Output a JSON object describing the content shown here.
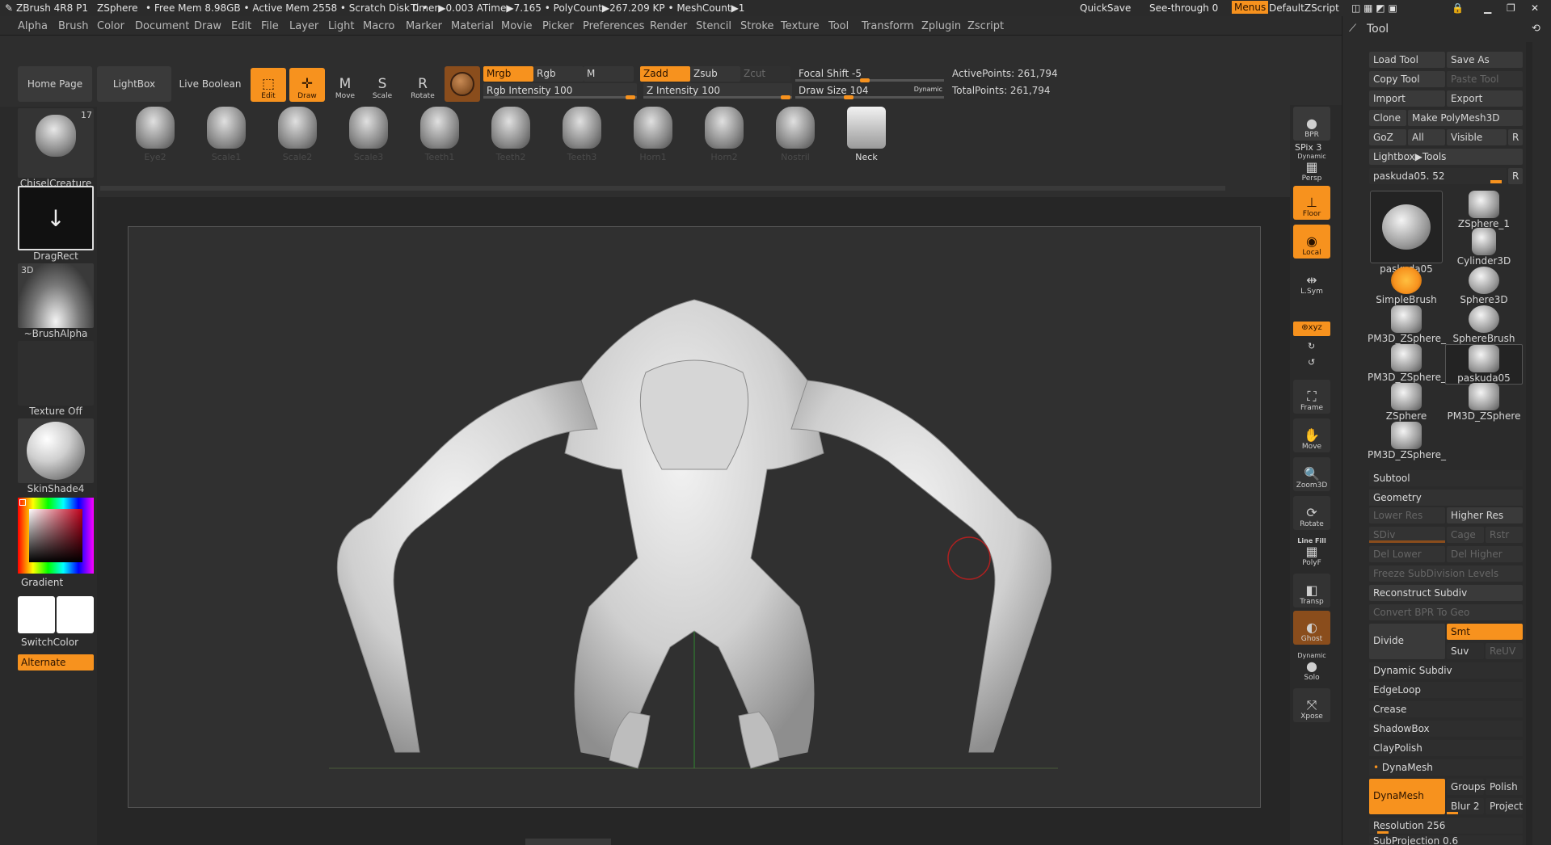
{
  "titlebar": {
    "app": "ZBrush 4R8 P1",
    "project": "ZSphere",
    "stats": "• Free Mem 8.98GB • Active Mem 2558 • Scratch Disk 0 •",
    "timer": "Timer▶0.003 ATime▶7.165 • PolyCount▶267.209 KP • MeshCount▶1",
    "quicksave": "QuickSave",
    "seethrough": "See-through  0",
    "menus": "Menus",
    "script": "DefaultZScript"
  },
  "menubar": [
    "Alpha",
    "Brush",
    "Color",
    "Document",
    "Draw",
    "Edit",
    "File",
    "Layer",
    "Light",
    "Macro",
    "Marker",
    "Material",
    "Movie",
    "Picker",
    "Preferences",
    "Render",
    "Stencil",
    "Stroke",
    "Texture",
    "Tool",
    "Transform",
    "Zplugin",
    "Zscript"
  ],
  "shelf": {
    "home": "Home Page",
    "lightbox": "LightBox",
    "liveboolean": "Live Boolean",
    "edit": "Edit",
    "draw": "Draw",
    "move": "Move",
    "scale": "Scale",
    "rotate": "Rotate",
    "mrgb": "Mrgb",
    "rgb": "Rgb",
    "m": "M",
    "zadd": "Zadd",
    "zsub": "Zsub",
    "zcut": "Zcut",
    "rgb_intensity": "Rgb Intensity 100",
    "z_intensity": "Z Intensity 100",
    "focal_shift": "Focal Shift -5",
    "draw_size": "Draw Size 104",
    "dynamic": "Dynamic",
    "active_points": "ActivePoints: 261,794",
    "total_points": "TotalPoints: 261,794"
  },
  "brushes": [
    "Eye2",
    "Scale1",
    "Scale2",
    "Scale3",
    "Teeth1",
    "Teeth2",
    "Teeth3",
    "Horn1",
    "Horn2",
    "Nostril",
    "Neck"
  ],
  "leftshelf": {
    "brush_count": "17",
    "brush": "ChiselCreature",
    "stroke": "DragRect",
    "alpha": "~BrushAlpha",
    "alpha_tag": "3D",
    "texture": "Texture Off",
    "material": "SkinShade4",
    "gradient": "Gradient",
    "switchcolor": "SwitchColor",
    "alternate": "Alternate"
  },
  "rightshelf": {
    "bpr": "BPR",
    "spix": "SPix 3",
    "dynamic": "Dynamic",
    "persp": "Persp",
    "floor": "Floor",
    "local": "Local",
    "lsym": "L.Sym",
    "xyz": "⊕xyz",
    "frame": "Frame",
    "move": "Move",
    "zoom": "Zoom3D",
    "rotate": "Rotate",
    "linefill": "Line Fill",
    "polyf": "PolyF",
    "transp": "Transp",
    "ghost": "Ghost",
    "dynamic2": "Dynamic",
    "solo": "Solo",
    "xpose": "Xpose"
  },
  "tool": {
    "title": "Tool",
    "load": "Load Tool",
    "saveas": "Save As",
    "copy": "Copy Tool",
    "paste": "Paste Tool",
    "import": "Import",
    "export": "Export",
    "clone": "Clone",
    "makepoly": "Make PolyMesh3D",
    "goz": "GoZ",
    "all": "All",
    "visible": "Visible",
    "r": "R",
    "lightbox_tools": "Lightbox▶Tools",
    "current": "paskuda05. 52",
    "r2": "R",
    "items": [
      "paskuda05",
      "ZSphere_1",
      "Cylinder3D",
      "SimpleBrush",
      "Sphere3D",
      "PM3D_ZSphere_",
      "SphereBrush",
      "PM3D_ZSphere_",
      "paskuda05",
      "ZSphere",
      "PM3D_ZSphere",
      "PM3D_ZSphere_"
    ],
    "subtool": "Subtool",
    "geometry": "Geometry",
    "lower_res": "Lower Res",
    "higher_res": "Higher Res",
    "sdiv": "SDiv",
    "cage": "Cage",
    "rstr": "Rstr",
    "del_lower": "Del Lower",
    "del_higher": "Del Higher",
    "freeze": "Freeze SubDivision Levels",
    "reconstruct": "Reconstruct Subdiv",
    "convert": "Convert BPR To Geo",
    "divide": "Divide",
    "smt": "Smt",
    "suv": "Suv",
    "reuv": "ReUV",
    "dyn_subdiv": "Dynamic Subdiv",
    "edgeloop": "EdgeLoop",
    "crease": "Crease",
    "shadowbox": "ShadowBox",
    "claypolish": "ClayPolish",
    "dynamesh_hdr": "DynaMesh",
    "dynamesh": "DynaMesh",
    "groups": "Groups",
    "polish": "Polish",
    "blur": "Blur 2",
    "project": "Project",
    "resolution": "Resolution 256",
    "subprojection": "SubProjection 0.6"
  },
  "colors": {
    "accent": "#f7921e",
    "bg": "#262626",
    "panel": "#2b2b2b"
  }
}
